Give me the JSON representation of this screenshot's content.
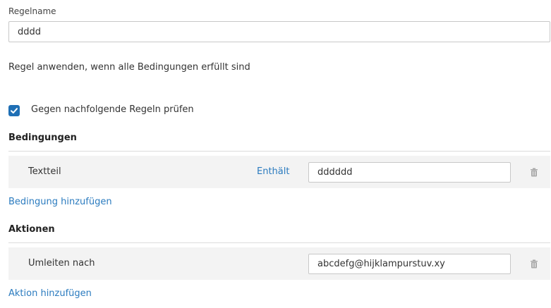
{
  "rule_name": {
    "label": "Regelname",
    "value": "dddd"
  },
  "apply_condition_text": "Regel anwenden, wenn alle Bedingungen erfüllt sind",
  "check_following_rules": {
    "label": "Gegen nachfolgende Regeln prüfen",
    "checked": true
  },
  "conditions": {
    "heading": "Bedingungen",
    "rows": [
      {
        "field": "Textteil",
        "operator": "Enthält",
        "value": "dddddd"
      }
    ],
    "add_link": "Bedingung hinzufügen"
  },
  "actions": {
    "heading": "Aktionen",
    "rows": [
      {
        "action": "Umleiten nach",
        "value": "abcdefg@hijklampurstuv.xy"
      }
    ],
    "add_link": "Aktion hinzufügen"
  },
  "colors": {
    "accent": "#2b7bbf",
    "checkbox": "#1f6fb5",
    "row_background": "#f3f3f3"
  }
}
